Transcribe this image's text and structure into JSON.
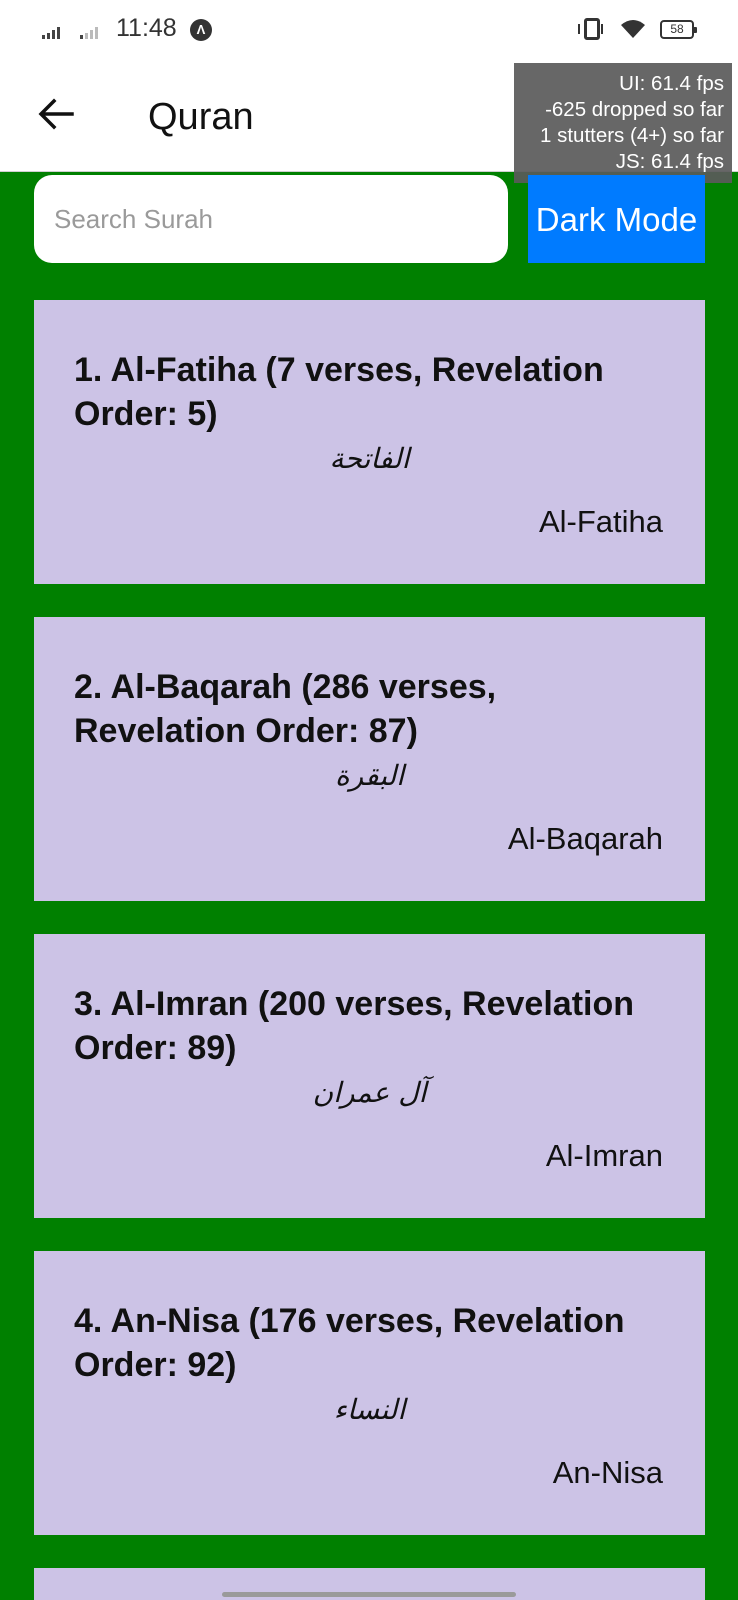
{
  "status_bar": {
    "time": "11:48",
    "battery": "58",
    "icons": [
      "signal-icon",
      "signal-icon",
      "app-notification-icon",
      "vibrate-icon",
      "wifi-icon",
      "battery-icon"
    ]
  },
  "app_bar": {
    "title": "Quran",
    "back_icon": "arrow-left-icon"
  },
  "perf_overlay": {
    "lines": [
      "UI: 61.4 fps",
      "-625 dropped so far",
      "1 stutters (4+) so far",
      "JS: 61.4 fps"
    ]
  },
  "search": {
    "placeholder": "Search Surah",
    "value": ""
  },
  "dark_mode_button": {
    "label": "Dark Mode"
  },
  "colors": {
    "background": "#008000",
    "card": "#ccc3e6",
    "button": "#007bff"
  },
  "surahs": [
    {
      "title": "1. Al-Fatiha (7 verses, Revelation Order: 5)",
      "arabic": "الفاتحة",
      "english": "Al-Fatiha"
    },
    {
      "title": "2. Al-Baqarah (286 verses, Revelation Order: 87)",
      "arabic": "البقرة",
      "english": "Al-Baqarah"
    },
    {
      "title": "3. Al-Imran (200 verses, Revelation Order: 89)",
      "arabic": "آل عمران",
      "english": "Al-Imran"
    },
    {
      "title": "4. An-Nisa (176 verses, Revelation Order: 92)",
      "arabic": "النساء",
      "english": "An-Nisa"
    }
  ]
}
